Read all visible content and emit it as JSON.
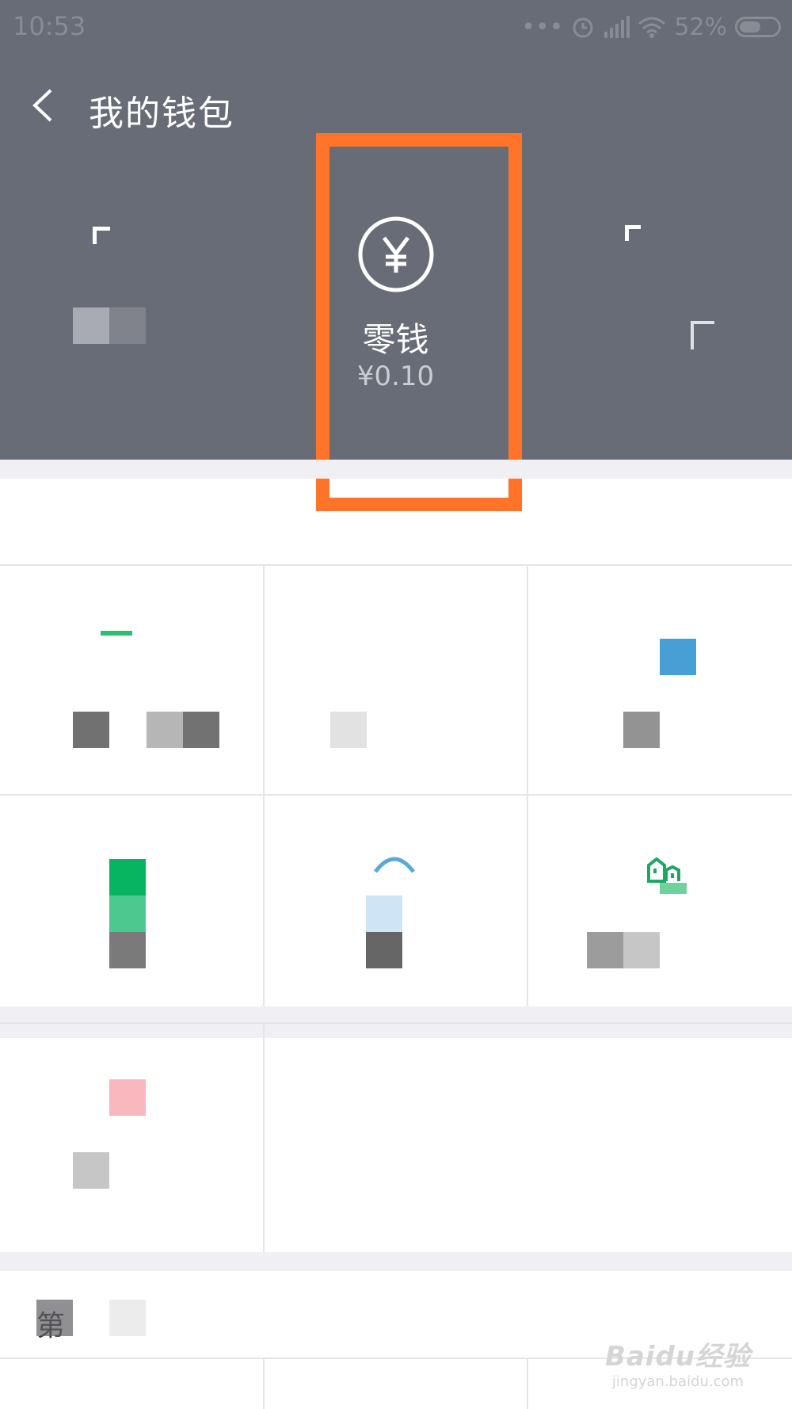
{
  "status_bar": {
    "time": "10:53",
    "dots": "•••",
    "battery": "52%"
  },
  "nav": {
    "title": "我的钱包",
    "back_icon": "chevron-left-icon"
  },
  "header_items": [
    {
      "label": "",
      "amount": ""
    },
    {
      "label": "零钱",
      "amount": "¥0.10",
      "icon": "yen-circle-icon"
    },
    {
      "label": "",
      "amount": ""
    }
  ],
  "colors": {
    "header_bg": "#676c77",
    "highlight": "#ff7428",
    "green": "#07b45f",
    "blue": "#479fd5"
  },
  "section": {
    "title": "第"
  },
  "watermark": {
    "brand": "Baidu经验",
    "url": "jingyan.baidu.com"
  }
}
